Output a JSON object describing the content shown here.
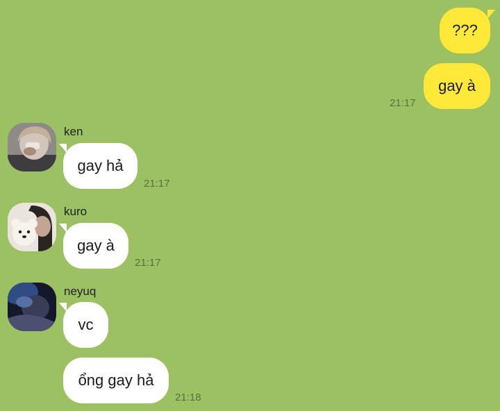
{
  "colors": {
    "background": "#9bc163",
    "outgoing_bubble": "#fee93b",
    "incoming_bubble": "#ffffff",
    "timestamp": "#5b6e43"
  },
  "outgoing": [
    {
      "text": "???"
    },
    {
      "text": "gay à",
      "time": "21:17"
    }
  ],
  "incoming": [
    {
      "sender": "ken",
      "avatar_icon": "user-photo-icon",
      "messages": [
        {
          "text": "gay hả",
          "time": "21:17"
        }
      ]
    },
    {
      "sender": "kuro",
      "avatar_icon": "user-photo-teddy-bear-icon",
      "messages": [
        {
          "text": "gay à",
          "time": "21:17"
        }
      ]
    },
    {
      "sender": "neyuq",
      "avatar_icon": "user-photo-dark-icon",
      "messages": [
        {
          "text": "vc"
        },
        {
          "text": "ổng gay hả",
          "time": "21:18"
        }
      ]
    }
  ]
}
